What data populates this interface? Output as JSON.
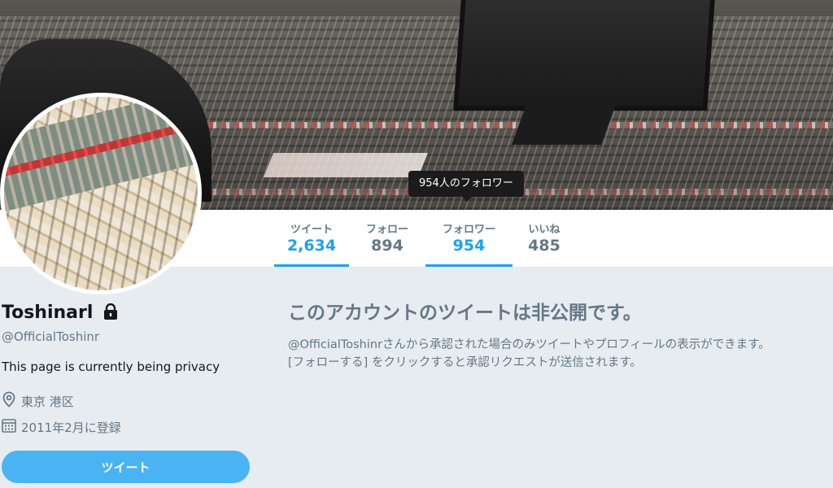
{
  "tooltip": {
    "text": "954人のフォロワー"
  },
  "nav": {
    "items": [
      {
        "label": "ツイート",
        "value": "2,634",
        "active": true
      },
      {
        "label": "フォロー",
        "value": "894",
        "active": false
      },
      {
        "label": "フォロワー",
        "value": "954",
        "active": true
      },
      {
        "label": "いいね",
        "value": "485",
        "active": false
      }
    ]
  },
  "profile": {
    "name": "Toshinarl",
    "handle": "@OfficialToshinr",
    "bio": "This page is currently being privacy",
    "location": "東京 港区",
    "joined": "2011年2月に登録",
    "tweet_button": "ツイート",
    "private_icon": "lock-icon"
  },
  "private_notice": {
    "title": "このアカウントのツイートは非公開です。",
    "line1": "@OfficialToshinrさんから承認された場合のみツイートやプロフィールの表示ができます。",
    "line2": "[フォローする] をクリックすると承認リクエストが送信されます。"
  },
  "colors": {
    "accent": "#1da1f2",
    "button": "#4ab3f4",
    "muted": "#657786",
    "background": "#e6ecf0"
  }
}
